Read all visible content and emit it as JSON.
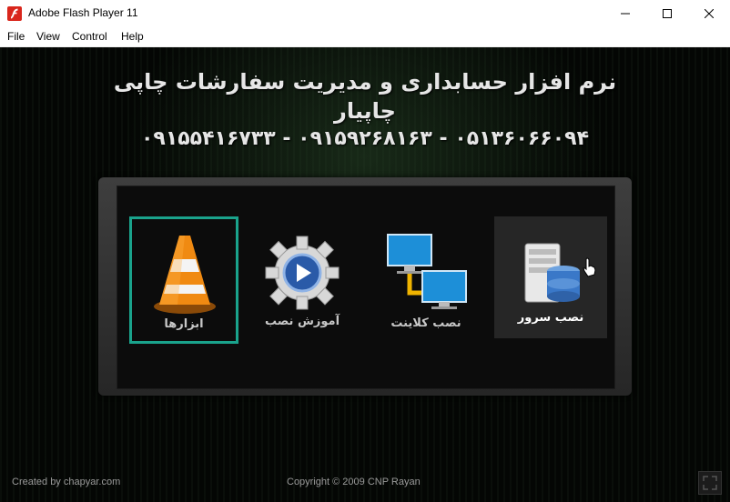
{
  "window": {
    "title": "Adobe Flash Player 11",
    "controls": {
      "minimize": "minimize-icon",
      "maximize": "maximize-icon",
      "close": "close-icon"
    }
  },
  "menu": [
    "File",
    "View",
    "Control",
    "Help"
  ],
  "header": {
    "line1": "نرم افزار حسابداری و مدیریت سفارشات چاپی",
    "line2": "چاپیار",
    "line3": "۰۵۱۳۶۰۶۶۰۹۴ - ۰۹۱۵۹۲۶۸۱۶۳ - ۰۹۱۵۵۴۱۶۷۳۳"
  },
  "tiles": [
    {
      "label": "ابزارها",
      "icon": "traffic-cone-icon",
      "selected": true
    },
    {
      "label": "آموزش نصب",
      "icon": "gear-play-icon"
    },
    {
      "label": "نصب کلاینت",
      "icon": "network-monitors-icon"
    },
    {
      "label": "نصب سرور",
      "icon": "server-database-icon",
      "hover": true
    }
  ],
  "footer": {
    "created_by": "Created by chapyar.com",
    "copyright": "Copyright © 2009 CNP Rayan"
  },
  "colors": {
    "selection_border": "#1aa38c",
    "flash_red": "#d9261c",
    "hover_tile": "#262626"
  }
}
